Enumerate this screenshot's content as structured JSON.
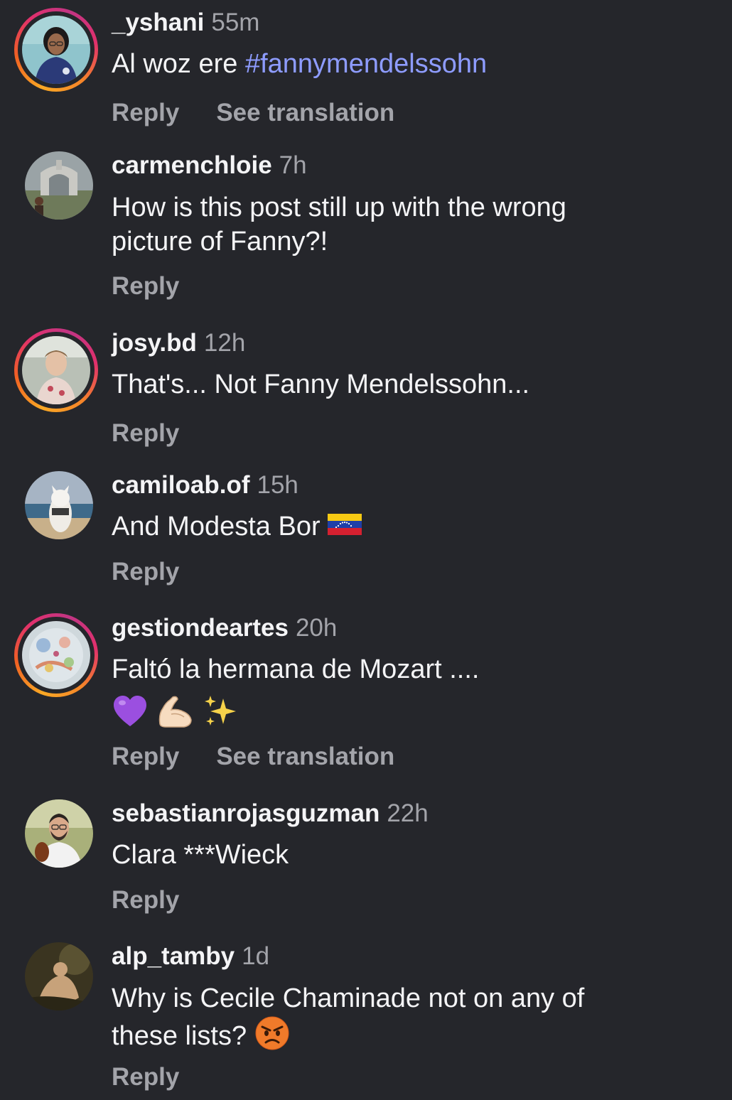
{
  "comments": [
    {
      "username": "_yshani",
      "time": "55m",
      "text": "Al woz ere ",
      "hashtag": "#fannymendelssohn",
      "reply": "Reply",
      "translate": "See translation",
      "story_ring": true
    },
    {
      "username": "carmenchloie",
      "time": "7h",
      "text_line1": "How is this post still up with the wrong",
      "text_line2": "picture of Fanny?!",
      "reply": "Reply",
      "story_ring": false
    },
    {
      "username": "josy.bd",
      "time": "12h",
      "text": "That's... Not Fanny Mendelssohn...",
      "reply": "Reply",
      "story_ring": true
    },
    {
      "username": "camiloab.of",
      "time": "15h",
      "text": "And Modesta Bor ",
      "emoji": "venezuela-flag-icon",
      "reply": "Reply",
      "story_ring": false
    },
    {
      "username": "gestiondeartes",
      "time": "20h",
      "text": "Faltó la hermana de Mozart ....",
      "emojis": [
        "purple-heart-icon",
        "flexed-biceps-icon",
        "sparkles-icon"
      ],
      "reply": "Reply",
      "translate": "See translation",
      "story_ring": true
    },
    {
      "username": "sebastianrojasguzman",
      "time": "22h",
      "text": "Clara ***Wieck",
      "reply": "Reply",
      "story_ring": false
    },
    {
      "username": "alp_tamby",
      "time": "1d",
      "text_line1": "Why is Cecile Chaminade not on any of",
      "text_line2": "these lists? ",
      "emoji": "angry-face-icon",
      "reply": "Reply",
      "story_ring": false
    }
  ],
  "colors": {
    "background": "#25262b",
    "hashtag": "#8e9cff",
    "secondary_text": "#a3a4aa"
  }
}
